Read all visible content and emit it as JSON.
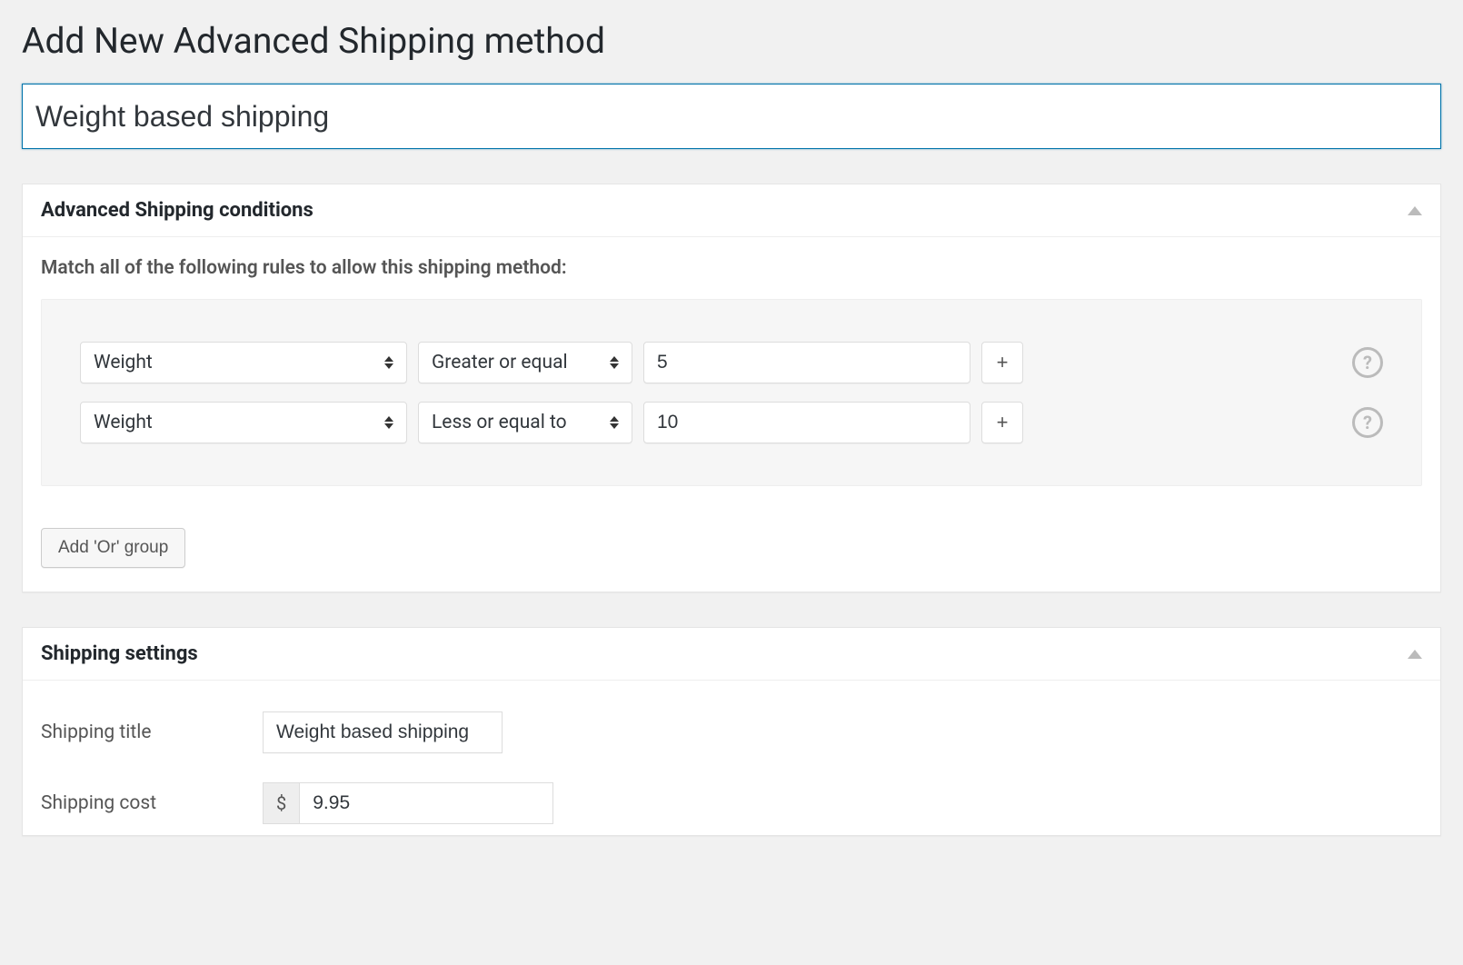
{
  "page": {
    "title": "Add New Advanced Shipping method",
    "name_input": "Weight based shipping"
  },
  "conditions_panel": {
    "heading": "Advanced Shipping conditions",
    "instruction": "Match all of the following rules to allow this shipping method:",
    "rows": [
      {
        "condition": "Weight",
        "operator": "Greater or equal",
        "value": "5"
      },
      {
        "condition": "Weight",
        "operator": "Less or equal to",
        "value": "10"
      }
    ],
    "add_row_label": "+",
    "help_label": "?",
    "add_or_group_label": "Add 'Or' group"
  },
  "settings_panel": {
    "heading": "Shipping settings",
    "title_label": "Shipping title",
    "title_value": "Weight based shipping",
    "cost_label": "Shipping cost",
    "cost_currency": "$",
    "cost_value": "9.95"
  }
}
